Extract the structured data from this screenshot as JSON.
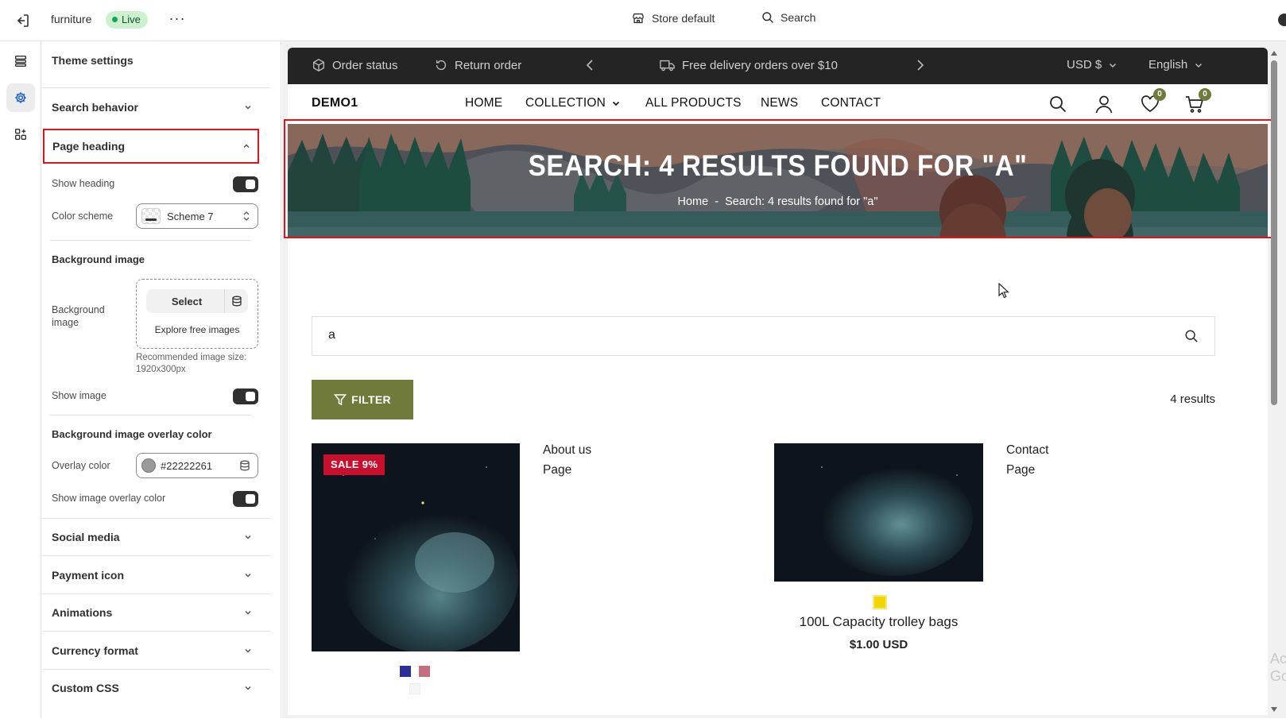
{
  "topbar": {
    "store_name": "furniture",
    "status": "Live",
    "more": "···",
    "store_default": "Store default",
    "search": "Search"
  },
  "panel": {
    "title": "Theme settings",
    "search_behavior": "Search behavior",
    "page_heading": "Page heading",
    "show_heading": "Show heading",
    "color_scheme_label": "Color scheme",
    "color_scheme_value": "Scheme 7",
    "background_image_title": "Background image",
    "background_image_label": "Background image",
    "select": "Select",
    "explore": "Explore free images",
    "hint": "Recommended image size: 1920x300px",
    "show_image": "Show image",
    "overlay_title": "Background image overlay color",
    "overlay_label": "Overlay color",
    "overlay_value": "#22222261",
    "show_overlay": "Show image overlay color",
    "sections": [
      "Social media",
      "Payment icon",
      "Animations",
      "Currency format",
      "Custom CSS"
    ]
  },
  "store": {
    "announce": {
      "order_status": "Order status",
      "return_order": "Return order",
      "message": "Free delivery orders over $10",
      "currency": "USD $",
      "language": "English"
    },
    "logo": "DEMO1",
    "nav": [
      "HOME",
      "COLLECTION",
      "ALL PRODUCTS",
      "NEWS",
      "CONTACT"
    ],
    "wishlist_count": "0",
    "cart_count": "0",
    "heading": "SEARCH: 4 RESULTS FOUND FOR \"A\"",
    "breadcrumb_home": "Home",
    "breadcrumb_sep": "-",
    "breadcrumb_current": "Search: 4 results found for \"a\"",
    "search_value": "a",
    "filter": "FILTER",
    "results_count": "4 results",
    "results": [
      {
        "type": "product",
        "badge": "SALE 9%",
        "swatches": [
          "#2b2f9a",
          "#c46f7e",
          "#f5f5f5"
        ]
      },
      {
        "type": "page",
        "title": "About us",
        "subtitle": "Page"
      },
      {
        "type": "product",
        "title": "100L Capacity trolley bags",
        "price": "$1.00 USD",
        "swatches": [
          "#f3d500"
        ]
      },
      {
        "type": "page",
        "title": "Contact",
        "subtitle": "Page"
      }
    ]
  },
  "colors": {
    "accent_olive": "#6f7a3b",
    "sale_red": "#c8102e",
    "highlight_red": "#e0141e",
    "live_green": "#cdf1cf",
    "announce_bg": "#242424"
  },
  "watermark": "Ac\nGo"
}
